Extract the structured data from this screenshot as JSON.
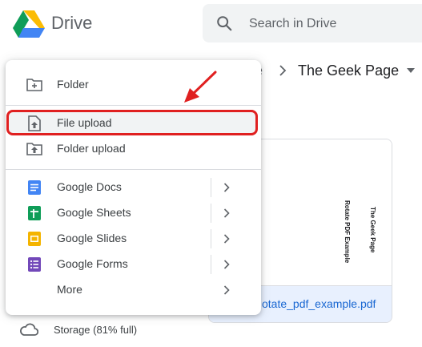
{
  "app": {
    "brand": "Drive"
  },
  "search": {
    "placeholder": "Search in Drive"
  },
  "breadcrumb": {
    "previous": "e",
    "current": "The Geek Page"
  },
  "file": {
    "name": "otate_pdf_example.pdf",
    "preview_texts": [
      "The Geek Page",
      "Rotate PDF Example"
    ]
  },
  "storage": {
    "label": "Storage (81% full)"
  },
  "menu": {
    "items": [
      {
        "label": "Folder",
        "icon": "folder-plus-icon"
      },
      {
        "label": "File upload",
        "icon": "file-upload-icon",
        "highlighted": true
      },
      {
        "label": "Folder upload",
        "icon": "folder-upload-icon"
      },
      {
        "label": "Google Docs",
        "icon": "google-docs-icon",
        "submenu": true
      },
      {
        "label": "Google Sheets",
        "icon": "google-sheets-icon",
        "submenu": true
      },
      {
        "label": "Google Slides",
        "icon": "google-slides-icon",
        "submenu": true
      },
      {
        "label": "Google Forms",
        "icon": "google-forms-icon",
        "submenu": true
      },
      {
        "label": "More",
        "icon": "",
        "submenu": true
      }
    ]
  },
  "colors": {
    "highlight_border": "#e02020",
    "docs": "#4285f4",
    "sheets": "#0f9d58",
    "slides": "#f4b400",
    "forms": "#7248b9",
    "link": "#1967d2"
  }
}
